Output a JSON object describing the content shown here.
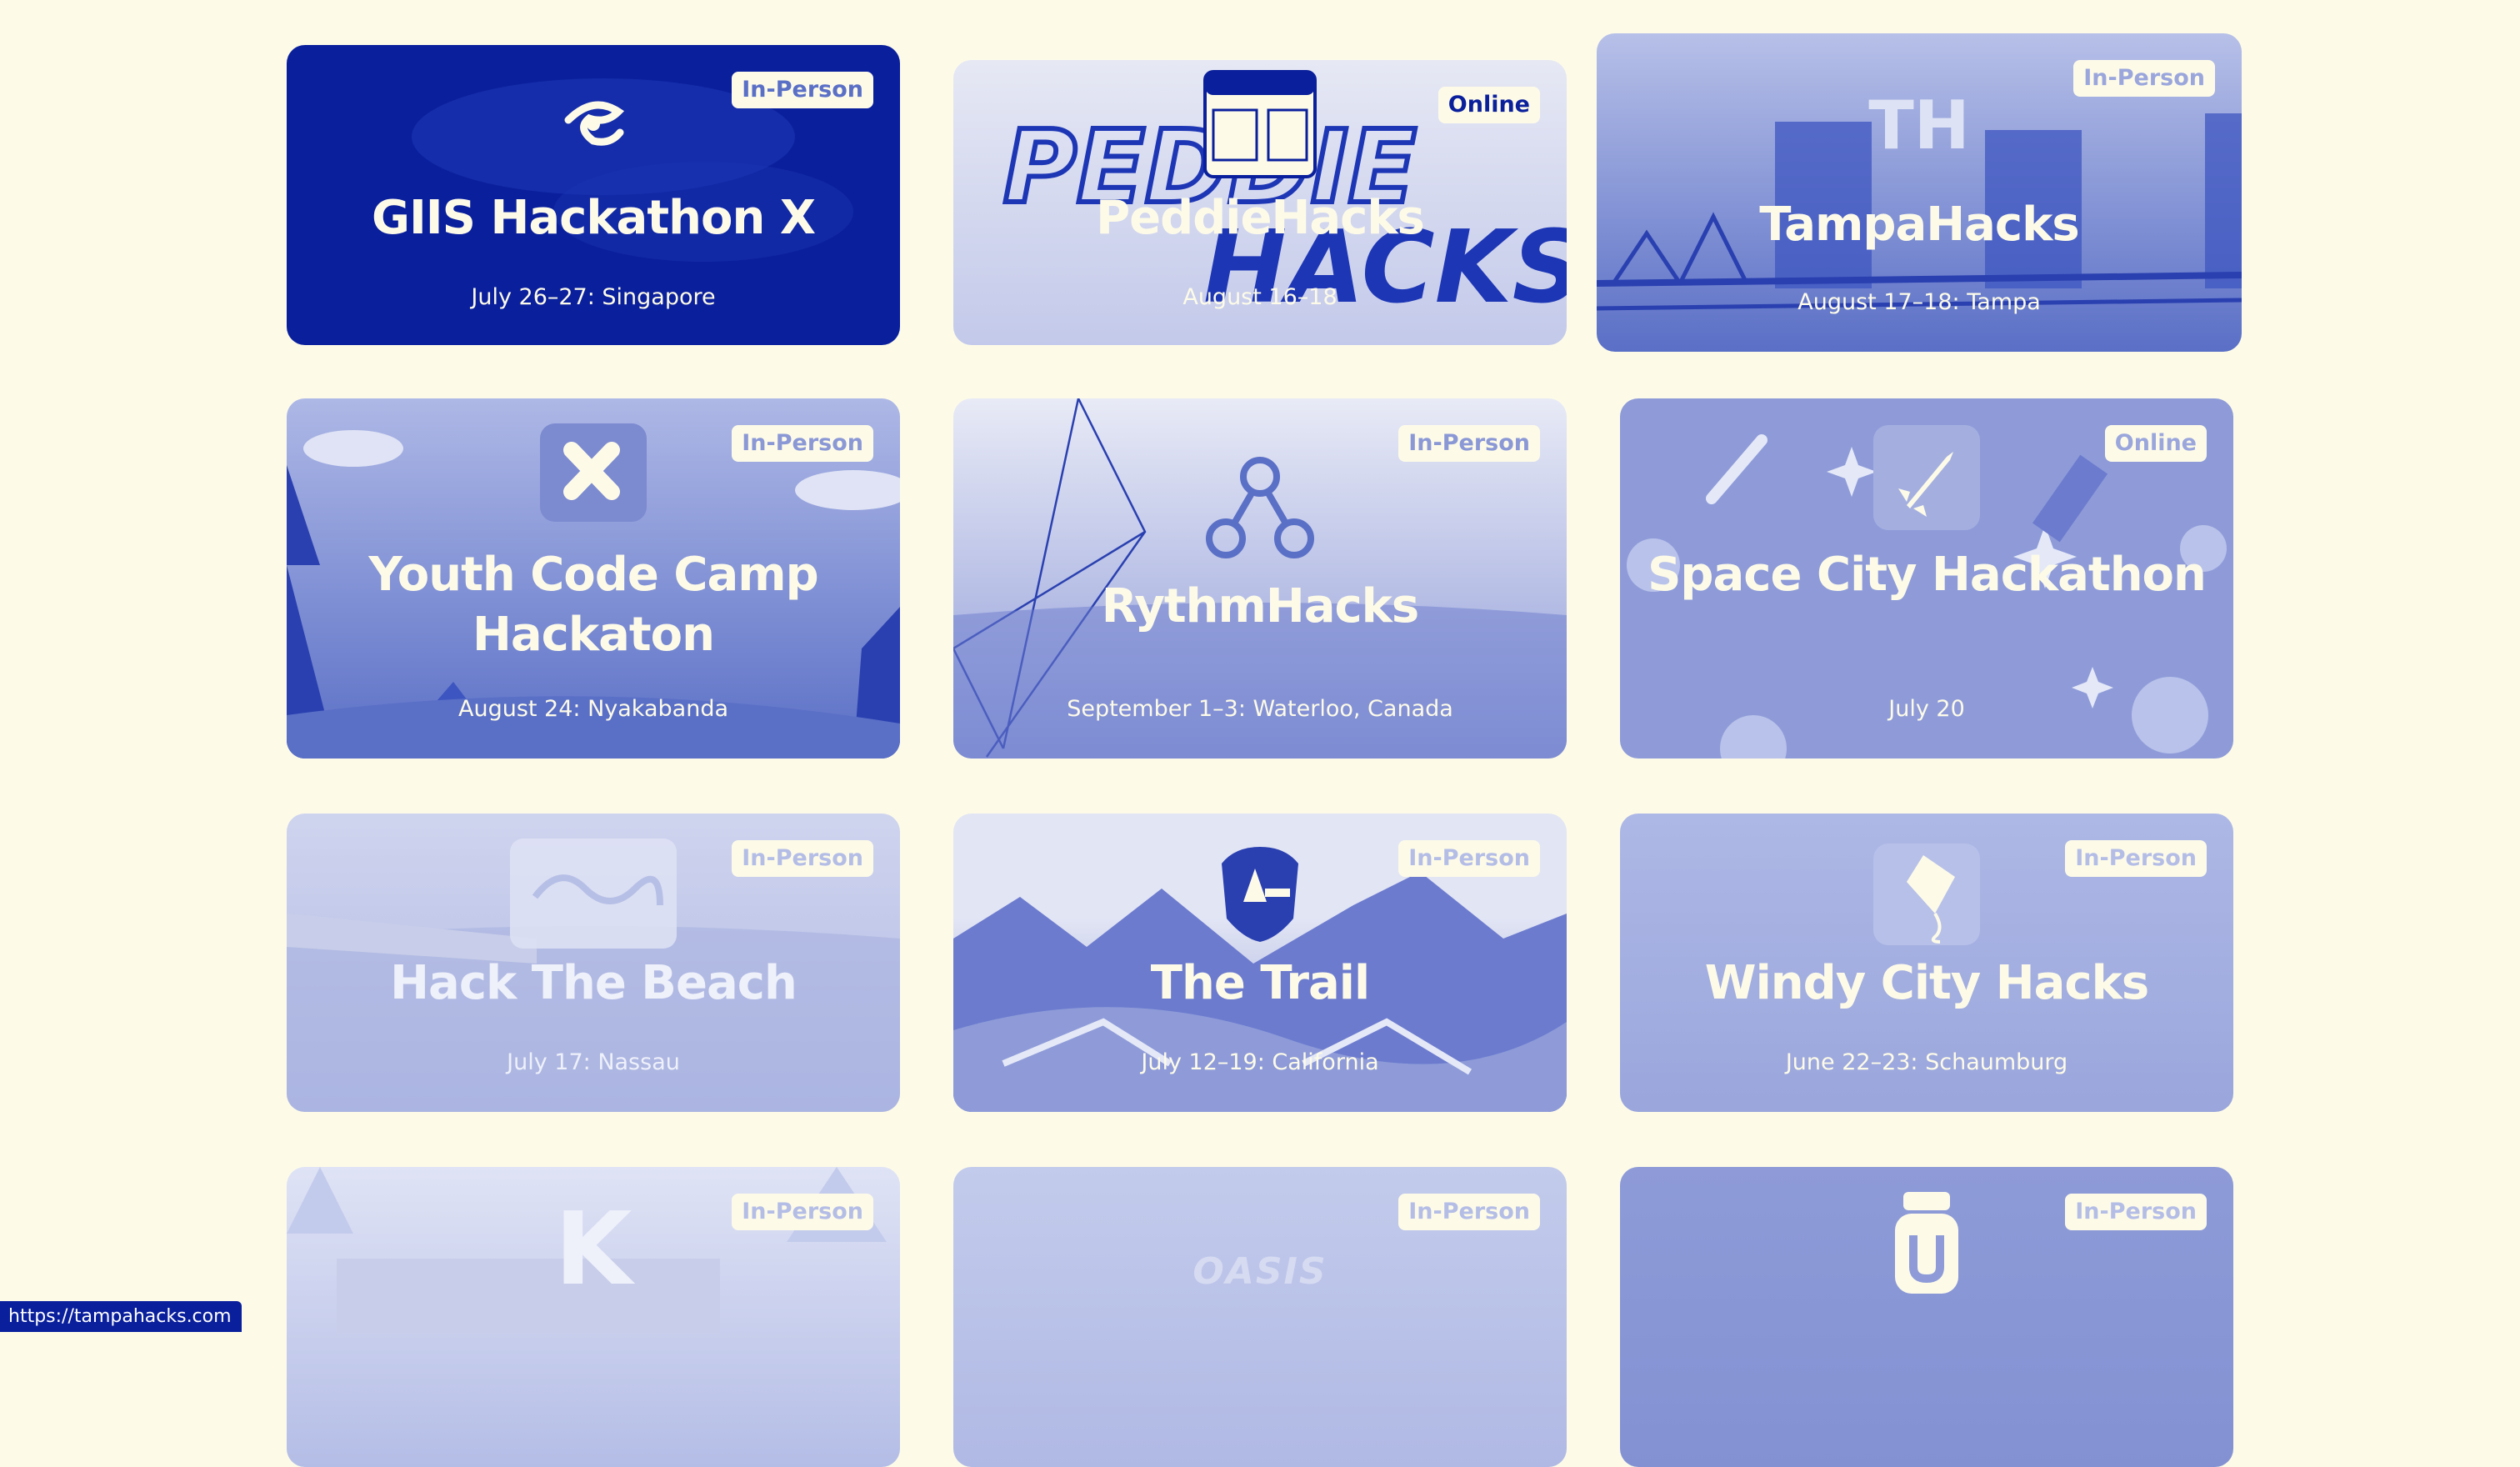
{
  "colors": {
    "background": "#fdfbe8",
    "brand_dark": "#0a1f9c",
    "card_mid": "#5a6fc6",
    "card_light": "#9aa6dc",
    "card_faded": "#b4bde6"
  },
  "cards": [
    {
      "title": "GIIS Hackathon X",
      "date": "July 26–27: Singapore",
      "badge": "In-Person",
      "logo": "giis-logo-icon"
    },
    {
      "title": "PeddieHacks",
      "date": "August 16–18",
      "badge": "Online",
      "logo": "boarding-pass-icon",
      "art_text": "PEDDIE HACKS"
    },
    {
      "title": "TampaHacks",
      "date": "August 17–18: Tampa",
      "badge": "In-Person",
      "logo_text": "TH"
    },
    {
      "title": "Youth Code Camp Hackaton",
      "date": "August 24: Nyakabanda",
      "badge": "In-Person",
      "logo": "xplus-logo-icon"
    },
    {
      "title": "RythmHacks",
      "date": "September 1–3: Waterloo, Canada",
      "badge": "In-Person",
      "logo": "network-node-icon"
    },
    {
      "title": "Space City Hackathon",
      "date": "July 20",
      "badge": "Online",
      "logo": "rocket-icon"
    },
    {
      "title": "Hack The Beach",
      "date": "July 17: Nassau",
      "badge": "In-Person",
      "logo": "script-logo-icon"
    },
    {
      "title": "The Trail",
      "date": "July 12–19: California",
      "badge": "In-Person",
      "logo": "park-shield-icon"
    },
    {
      "title": "Windy City Hacks",
      "date": "June 22–23: Schaumburg",
      "badge": "In-Person",
      "logo": "kite-icon"
    },
    {
      "title": "",
      "date": "",
      "badge": "In-Person",
      "logo_text": "K"
    },
    {
      "title": "",
      "date": "",
      "badge": "In-Person",
      "logo_text": "OASIS"
    },
    {
      "title": "",
      "date": "",
      "badge": "In-Person",
      "logo": "jar-icon"
    }
  ],
  "status_bar": {
    "url": "https://tampahacks.com"
  }
}
